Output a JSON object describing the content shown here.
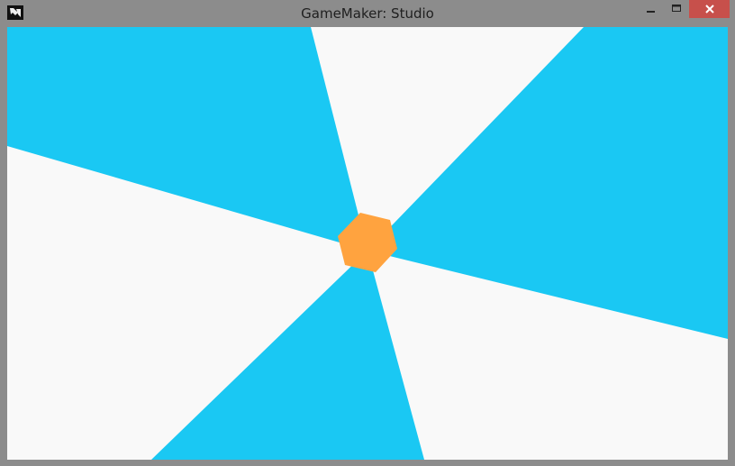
{
  "window": {
    "title": "GameMaker: Studio",
    "icons": {
      "app": "gamemaker-logo-icon",
      "minimize": "minimize-icon",
      "maximize": "maximize-icon",
      "close": "close-icon"
    }
  },
  "game": {
    "colors": {
      "background": "#f9f9f9",
      "stripes": "#1ac8f3",
      "hexagon": "#ffa33f",
      "close_button": "#c7504b",
      "titlebar": "#8c8c8c"
    }
  }
}
